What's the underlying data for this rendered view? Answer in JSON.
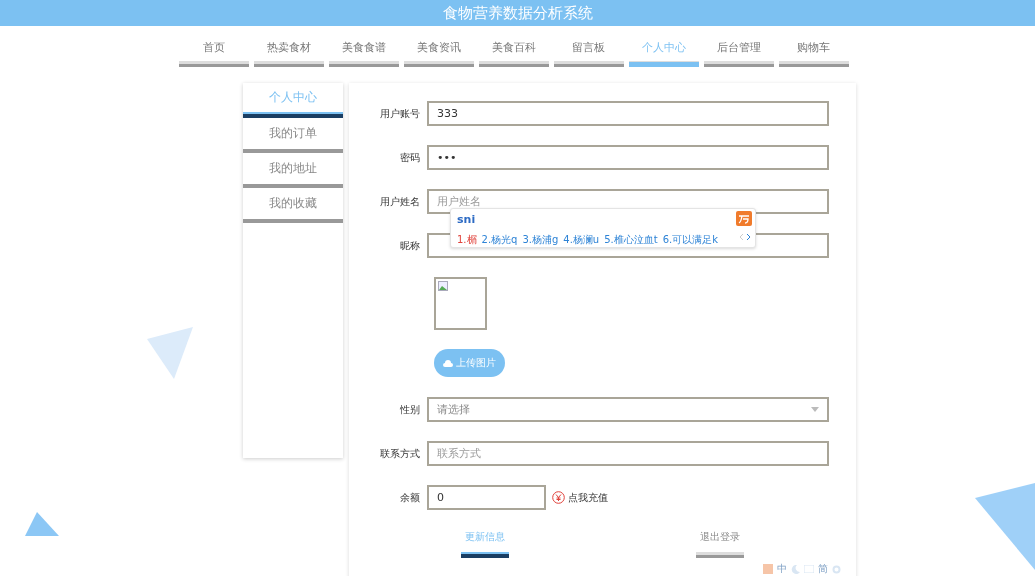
{
  "header": {
    "title": "食物营养数据分析系统"
  },
  "nav": [
    {
      "label": "首页",
      "selected": false
    },
    {
      "label": "热卖食材",
      "selected": false
    },
    {
      "label": "美食食谱",
      "selected": false
    },
    {
      "label": "美食资讯",
      "selected": false
    },
    {
      "label": "美食百科",
      "selected": false
    },
    {
      "label": "留言板",
      "selected": false
    },
    {
      "label": "个人中心",
      "selected": true
    },
    {
      "label": "后台管理",
      "selected": false
    },
    {
      "label": "购物车",
      "selected": false
    }
  ],
  "sidebar": {
    "items": [
      {
        "label": "个人中心",
        "selected": true
      },
      {
        "label": "我的订单",
        "selected": false
      },
      {
        "label": "我的地址",
        "selected": false
      },
      {
        "label": "我的收藏",
        "selected": false
      }
    ]
  },
  "form": {
    "fields": [
      {
        "kind": "text",
        "label": "用户账号",
        "value": "333"
      },
      {
        "kind": "text",
        "label": "密码",
        "value": "•••"
      },
      {
        "kind": "text",
        "label": "用户姓名",
        "placeholder": "用户姓名"
      },
      {
        "kind": "text",
        "label": "昵称"
      },
      {
        "kind": "image",
        "button": "上传图片"
      },
      {
        "kind": "select",
        "label": "性别",
        "placeholder": "请选择"
      },
      {
        "kind": "text",
        "label": "联系方式",
        "placeholder": "联系方式"
      },
      {
        "kind": "balance",
        "label": "余额",
        "value": "0",
        "link": "点我充值"
      }
    ],
    "actions": [
      {
        "label": "更新信息",
        "selected": true
      },
      {
        "label": "退出登录",
        "selected": false
      }
    ]
  },
  "ime": {
    "input": "sni",
    "candidates": [
      {
        "label": "1.榍",
        "selected": true
      },
      {
        "label": "2.杨光q",
        "selected": false
      },
      {
        "label": "3.杨浦g",
        "selected": false
      },
      {
        "label": "4.杨澜u",
        "selected": false
      },
      {
        "label": "5.椎心泣血t",
        "selected": false
      },
      {
        "label": "6.可以满足k",
        "selected": false
      }
    ],
    "toolbar": [
      "中",
      "简"
    ]
  }
}
